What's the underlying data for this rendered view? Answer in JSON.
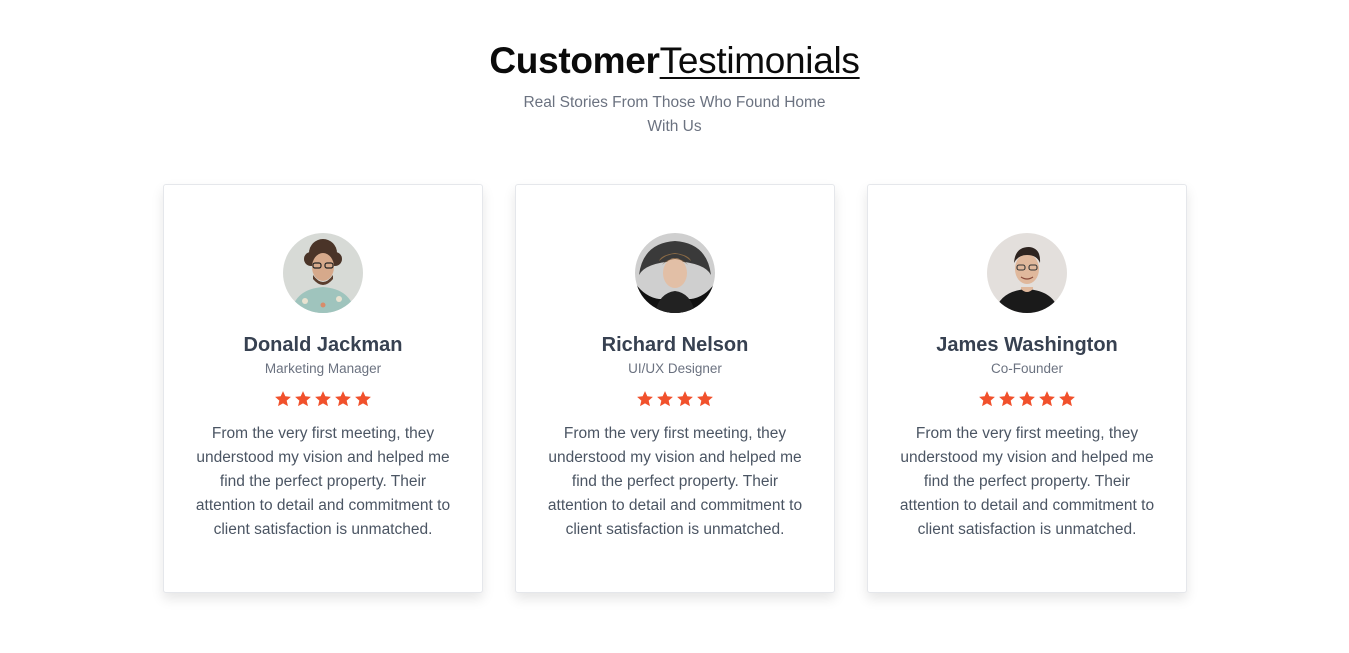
{
  "header": {
    "title_bold": "Customer",
    "title_light": "Testimonials",
    "subtitle": "Real Stories From Those Who Found Home With Us"
  },
  "colors": {
    "star": "#f1512c",
    "card_border": "#e5e7eb",
    "name": "#374151",
    "muted": "#6b7280"
  },
  "testimonials": [
    {
      "name": "Donald Jackman",
      "role": "Marketing Manager",
      "rating": 5,
      "quote": "From the very first meeting, they understood my vision and helped me find the perfect property. Their attention to detail and commitment to client satisfaction is unmatched.",
      "avatar_icon": "avatar-photo"
    },
    {
      "name": "Richard Nelson",
      "role": "UI/UX Designer",
      "rating": 4,
      "quote": "From the very first meeting, they understood my vision and helped me find the perfect property. Their attention to detail and commitment to client satisfaction is unmatched.",
      "avatar_icon": "avatar-photo"
    },
    {
      "name": "James Washington",
      "role": "Co-Founder",
      "rating": 5,
      "quote": "From the very first meeting, they understood my vision and helped me find the perfect property. Their attention to detail and commitment to client satisfaction is unmatched.",
      "avatar_icon": "avatar-photo"
    }
  ]
}
